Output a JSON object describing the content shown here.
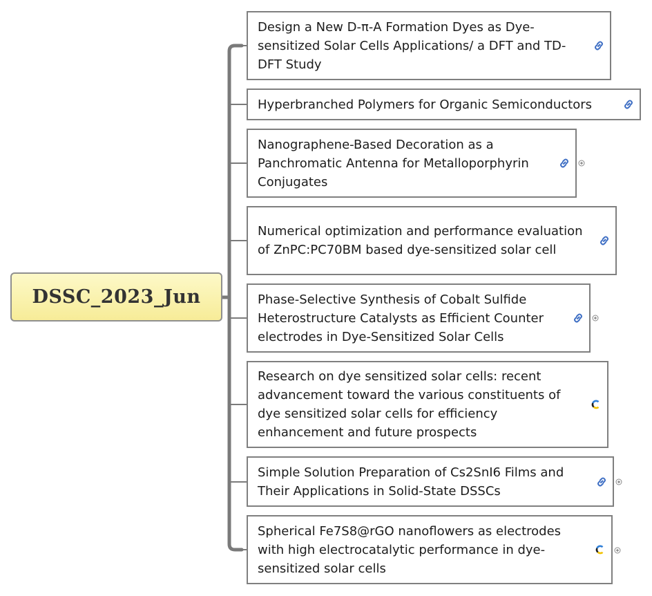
{
  "root": {
    "title": "DSSC_2023_Jun"
  },
  "topics": [
    {
      "text": "Design a New D-π-A Formation Dyes as Dye-sensitized Solar Cells Applications/ a DFT and TD-DFT Study",
      "icon": "link-icon",
      "collapsed": false
    },
    {
      "text": "Hyperbranched Polymers for Organic Semiconductors",
      "icon": "link-icon",
      "collapsed": false
    },
    {
      "text": "Nanographene-Based Decoration as a Panchromatic Antenna for Metalloporphyrin Conjugates",
      "icon": "link-icon",
      "collapsed": true
    },
    {
      "text": "Numerical optimization and performance evaluation of ZnPC:PC70BM based dye-sensitized solar cell",
      "icon": "link-icon",
      "collapsed": false
    },
    {
      "text": "Phase-Selective Synthesis of Cobalt Sulfide Heterostructure Catalysts as Efficient Counter electrodes in Dye-Sensitized Solar Cells",
      "icon": "link-icon",
      "collapsed": true
    },
    {
      "text": "Research on dye sensitized solar cells: recent advancement toward the various constituents of dye sensitized solar cells for efficiency enhancement and future prospects",
      "icon": "crossref-icon",
      "collapsed": false
    },
    {
      "text": "Simple Solution Preparation of Cs2SnI6 Films and Their Applications in Solid-State DSSCs",
      "icon": "link-icon",
      "collapsed": true
    },
    {
      "text": "Spherical Fe7S8@rGO nanoflowers as electrodes with high electrocatalytic performance in dye-sensitized solar cells",
      "icon": "crossref-icon",
      "collapsed": true
    }
  ],
  "colors": {
    "connector": "#7a7a7a",
    "node_border": "#7f7f7f",
    "root_fill": "#f7ec98",
    "link_icon": "#3f6fc4"
  }
}
